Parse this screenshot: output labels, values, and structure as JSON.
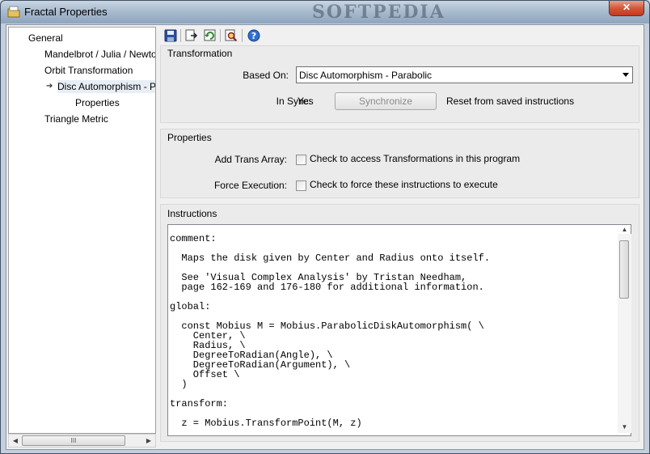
{
  "window": {
    "title": "Fractal Properties",
    "watermark": "SOFTPEDIA",
    "close_label": "✕"
  },
  "tree": {
    "items": [
      {
        "label": "General"
      },
      {
        "label": "Mandelbrot / Julia / Newton"
      },
      {
        "label": "Orbit Transformation"
      },
      {
        "label": "Disc Automorphism - Para"
      },
      {
        "label": "Properties"
      },
      {
        "label": "Triangle Metric"
      }
    ],
    "scroll_thumb_label": "III"
  },
  "toolbar": {
    "icons": [
      "save-icon",
      "export-icon",
      "refresh-icon",
      "find-icon",
      "help-icon"
    ]
  },
  "transformation": {
    "title": "Transformation",
    "based_on_label": "Based On:",
    "based_on_value": "Disc Automorphism - Parabolic",
    "in_sync_label": "In Sync:",
    "in_sync_value": "Yes",
    "synchronize_label": "Synchronize",
    "reset_label": "Reset from saved instructions"
  },
  "properties": {
    "title": "Properties",
    "add_trans_label": "Add Trans Array:",
    "add_trans_text": "Check to access Transformations in this program",
    "force_exec_label": "Force Execution:",
    "force_exec_text": "Check to force these instructions to execute"
  },
  "instructions": {
    "title": "Instructions",
    "code": "comment:\n\n  Maps the disk given by Center and Radius onto itself.\n\n  See 'Visual Complex Analysis' by Tristan Needham,\n  page 162-169 and 176-180 for additional information.\n\nglobal:\n\n  const Mobius M = Mobius.ParabolicDiskAutomorphism( \\\n    Center, \\\n    Radius, \\\n    DegreeToRadian(Angle), \\\n    DegreeToRadian(Argument), \\\n    Offset \\\n  )\n\ntransform:\n\n  z = Mobius.TransformPoint(M, z)"
  }
}
